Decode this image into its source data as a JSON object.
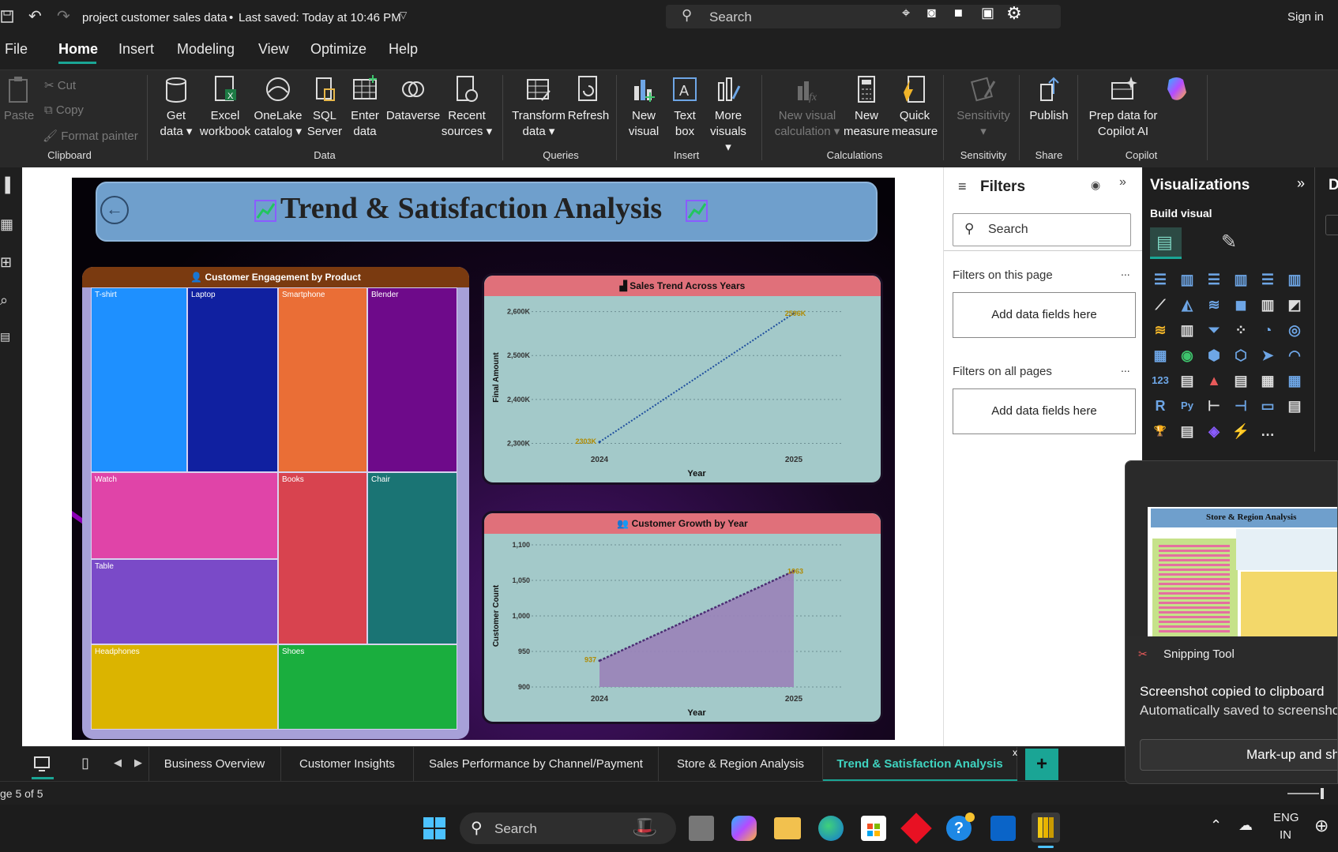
{
  "titlebar": {
    "doc_title": "project customer sales data",
    "saved_status": "Last saved: Today at 10:46 PM",
    "search_placeholder": "Search",
    "sign_in": "Sign in"
  },
  "menu": [
    "File",
    "Home",
    "Insert",
    "Modeling",
    "View",
    "Optimize",
    "Help"
  ],
  "ribbon": {
    "clipboard": {
      "paste": "Paste",
      "cut": "Cut",
      "copy": "Copy",
      "format_painter": "Format painter",
      "label": "Clipboard"
    },
    "data": {
      "get_data": "Get data",
      "excel": "Excel workbook",
      "onelake": "OneLake catalog",
      "sql": "SQL Server",
      "enter": "Enter data",
      "dataverse": "Dataverse",
      "recent": "Recent sources",
      "label": "Data"
    },
    "queries": {
      "transform": "Transform data",
      "refresh": "Refresh",
      "label": "Queries"
    },
    "insert": {
      "new_visual": "New visual",
      "text_box": "Text box",
      "more_visuals": "More visuals",
      "label": "Insert"
    },
    "calculations": {
      "new_visual_calc": "New visual calculation",
      "new_measure": "New measure",
      "quick_measure": "Quick measure",
      "label": "Calculations"
    },
    "sensitivity": {
      "btn": "Sensitivity",
      "label": "Sensitivity"
    },
    "share": {
      "publish": "Publish",
      "label": "Share"
    },
    "copilot": {
      "prep": "Prep data for Copilot AI",
      "label": "Copilot"
    }
  },
  "report": {
    "title": "Trend & Satisfaction Analysis",
    "treemap": {
      "title": "Customer Engagement by Product",
      "items": [
        "T-shirt",
        "Laptop",
        "Smartphone",
        "Blender",
        "Watch",
        "Books",
        "Chair",
        "Table",
        "Headphones",
        "Shoes"
      ]
    },
    "sales_chart": {
      "title": "Sales Trend Across Years"
    },
    "growth_chart": {
      "title": "Customer Growth by Year"
    }
  },
  "chart_data": [
    {
      "type": "line",
      "title": "Sales Trend Across Years",
      "x": [
        "2024",
        "2025"
      ],
      "series": [
        {
          "values": [
            2303,
            2596
          ]
        }
      ],
      "data_labels": [
        "2303K",
        "2596K"
      ],
      "ylabel": "Final Amount",
      "xlabel": "Year",
      "yticks": [
        "2,300K",
        "2,400K",
        "2,500K",
        "2,600K"
      ],
      "ylim": [
        2290,
        2610
      ],
      "grid": true
    },
    {
      "type": "area",
      "title": "Customer Growth by Year",
      "x": [
        "2024",
        "2025"
      ],
      "series": [
        {
          "values": [
            937,
            1063
          ]
        }
      ],
      "data_labels": [
        "937",
        "1063"
      ],
      "ylabel": "Customer Count",
      "xlabel": "Year",
      "yticks": [
        "900",
        "950",
        "1,000",
        "1,050",
        "1,100"
      ],
      "ylim": [
        900,
        1100
      ],
      "grid": true
    }
  ],
  "filters": {
    "title": "Filters",
    "search_placeholder": "Search",
    "this_page": "Filters on this page",
    "all_pages": "Filters on all pages",
    "add_fields": "Add data fields here",
    "more": "..."
  },
  "visualizations": {
    "title": "Visualizations",
    "build_visual": "Build visual",
    "next_pane": "D"
  },
  "tabs": [
    "Business Overview",
    "Customer Insights",
    "Sales Performance by Channel/Payment",
    "Store & Region Analysis",
    "Trend & Satisfaction Analysis"
  ],
  "active_tab": "Trend & Satisfaction Analysis",
  "status": {
    "page": "ge 5 of 5"
  },
  "toast": {
    "app": "Snipping Tool",
    "headline": "Screenshot copied to clipboard",
    "body": "Automatically saved to screensho",
    "button": "Mark-up and sh",
    "preview_title": "Store & Region Analysis"
  },
  "taskbar": {
    "search_placeholder": "Search",
    "lang_top": "ENG",
    "lang_bottom": "IN"
  },
  "colors": {
    "treemap": [
      "#1e90ff",
      "#1020a0",
      "#ea6e36",
      "#6e0a8a",
      "#e044a8",
      "#d8434f",
      "#1a7474",
      "#7a4ac8",
      "#dbb400",
      "#1aae3e"
    ],
    "accent_teal": "#1aa595",
    "header_blue": "#6f9fcc",
    "chart_head": "#e0707a",
    "chart_bg": "#a3c9c9"
  }
}
